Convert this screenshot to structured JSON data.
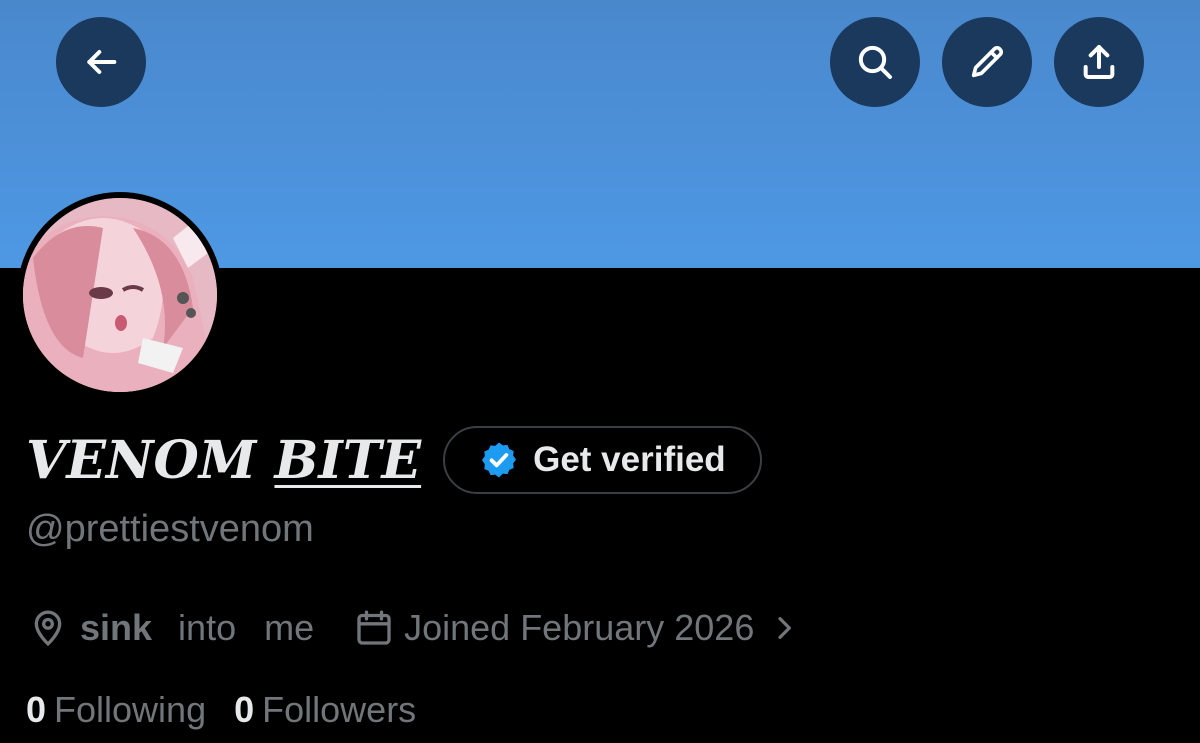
{
  "profile": {
    "name_part1": "VENOM ",
    "name_part2": "BITE",
    "handle": "@prettiestvenom",
    "verify_label": "Get verified",
    "location_words": [
      "sink",
      "into",
      "me"
    ],
    "joined": "Joined February 2026",
    "following_count": "0",
    "following_label": "Following",
    "followers_count": "0",
    "followers_label": "Followers"
  },
  "icons": {
    "back": "arrow-left-icon",
    "search": "search-icon",
    "edit": "pencil-icon",
    "share": "share-icon",
    "verified": "verified-badge-icon",
    "location": "location-pin-icon",
    "calendar": "calendar-icon",
    "chevron": "chevron-right-icon"
  },
  "colors": {
    "banner": "#4e98e4",
    "verified_blue": "#1d9bf0",
    "muted_text": "#71767b"
  }
}
